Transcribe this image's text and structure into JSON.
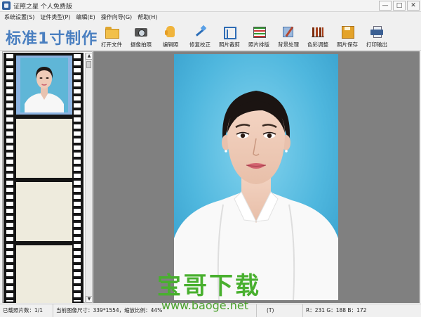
{
  "window": {
    "title": "证照之星 个人免费版",
    "minimize": "—",
    "restore": "□",
    "close": "✕"
  },
  "menu": [
    "系统设置(S)",
    "证件类型(P)",
    "编辑(E)",
    "操作向导(G)",
    "帮助(H)"
  ],
  "brand": "标准1寸制作",
  "toolbar": [
    {
      "label": "打开文件",
      "icon": "folder-icon"
    },
    {
      "label": "摄像拍照",
      "icon": "camera-icon"
    },
    {
      "label": "编辑照",
      "icon": "hand-icon"
    },
    {
      "label": "修复校正",
      "icon": "wand-icon"
    },
    {
      "label": "照片裁剪",
      "icon": "crop-icon"
    },
    {
      "label": "照片排版",
      "icon": "layout-icon"
    },
    {
      "label": "背景处理",
      "icon": "brush-icon"
    },
    {
      "label": "色彩调整",
      "icon": "levels-icon"
    },
    {
      "label": "照片保存",
      "icon": "save-icon"
    },
    {
      "label": "打印输出",
      "icon": "print-icon"
    }
  ],
  "filmstrip": {
    "scroll_up": "▲",
    "scroll_down": "▼"
  },
  "status": {
    "loaded": "已载照片数：1/1",
    "size": "当前图像尺寸：339*1554，缩放比例：44%",
    "mode": "(T)",
    "rgb": "R：231  G：188  B：172"
  },
  "watermark": {
    "main": "宝哥下载",
    "url": "www.baoge.net"
  },
  "colors": {
    "brand": "#4a7fc0",
    "photo_background": "#4fb7de",
    "canvas": "#808080",
    "watermark": "#49b02f"
  }
}
